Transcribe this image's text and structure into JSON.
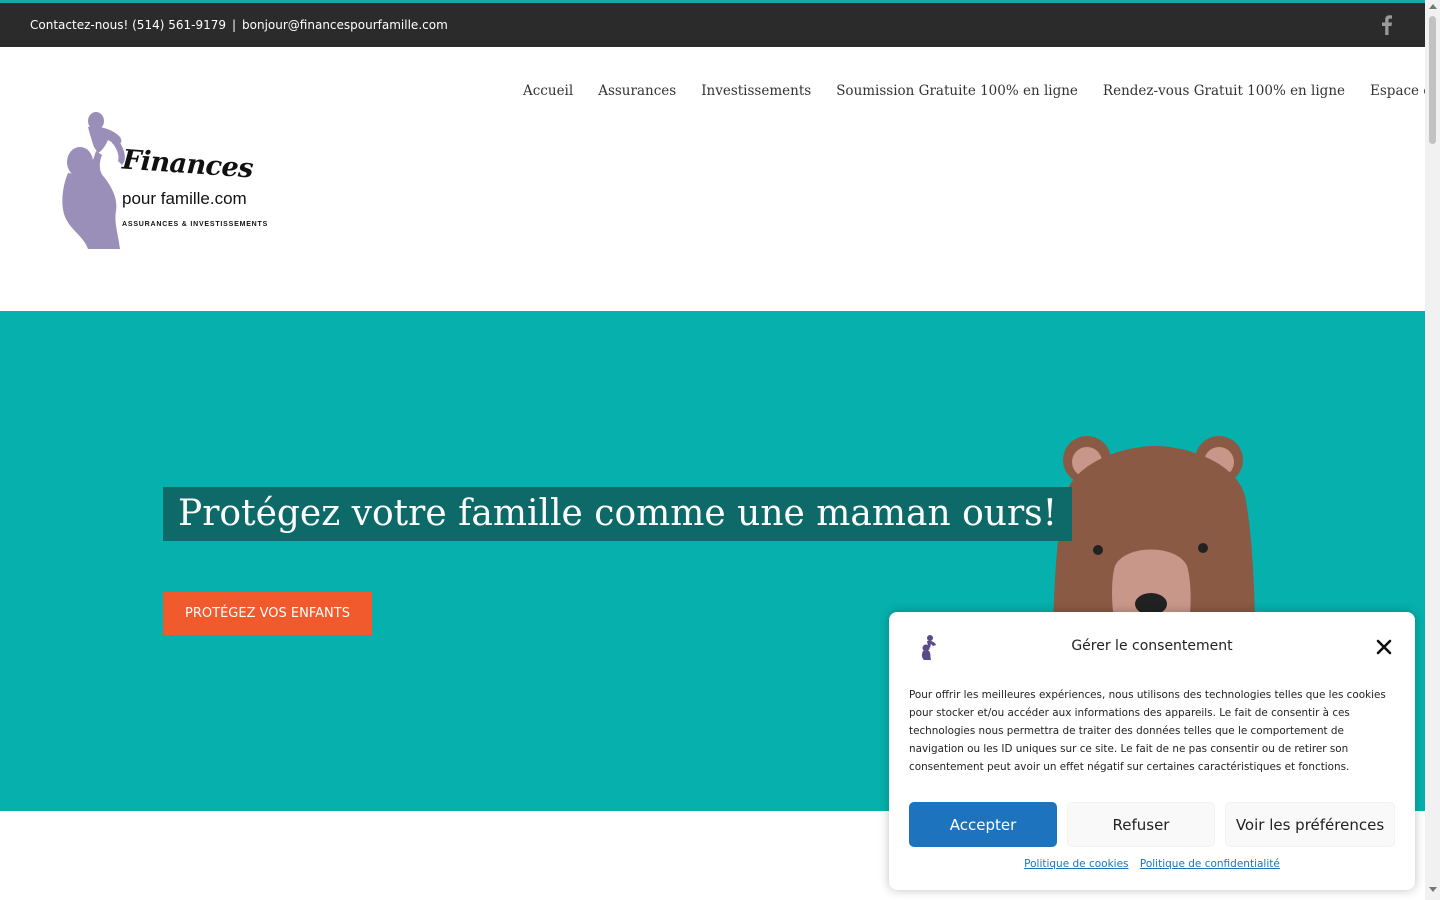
{
  "topbar": {
    "phone_text": "Contactez-nous! (514) 561-9179",
    "separator": "|",
    "email": "bonjour@financespourfamille.com",
    "social_icon": "facebook-icon"
  },
  "header": {
    "nav": [
      {
        "label": "Accueil"
      },
      {
        "label": "Assurances"
      },
      {
        "label": "Investissements"
      },
      {
        "label": "Soumission Gratuite 100% en ligne"
      },
      {
        "label": "Rendez-vous Gratuit 100% en ligne"
      },
      {
        "label": "Espace client"
      }
    ],
    "logo": {
      "script": "Finances",
      "domain": "pour famille.com",
      "tagline": "ASSURANCES & INVESTISSEMENTS"
    }
  },
  "hero": {
    "headline": "Protégez votre famille comme une maman ours!",
    "cta_label": "PROTÉGEZ VOS ENFANTS"
  },
  "consent": {
    "title": "Gérer le consentement",
    "body": "Pour offrir les meilleures expériences, nous utilisons des technologies telles que les cookies pour stocker et/ou accéder aux informations des appareils. Le fait de consentir à ces technologies nous permettra de traiter des données telles que le comportement de navigation ou les ID uniques sur ce site. Le fait de ne pas consentir ou de retirer son consentement peut avoir un effet négatif sur certaines caractéristiques et fonctions.",
    "accept_label": "Accepter",
    "refuse_label": "Refuser",
    "prefs_label": "Voir les préférences",
    "cookie_policy_label": "Politique de cookies",
    "privacy_policy_label": "Politique de confidentialité"
  },
  "colors": {
    "topbar_bg": "#2b2b2b",
    "accent_teal": "#06b0ad",
    "headline_bg": "#0d6a69",
    "cta_orange": "#f15a2c",
    "accept_blue": "#1e73be",
    "logo_purple": "#9a8fb8",
    "bear_brown": "#8a5a44"
  }
}
